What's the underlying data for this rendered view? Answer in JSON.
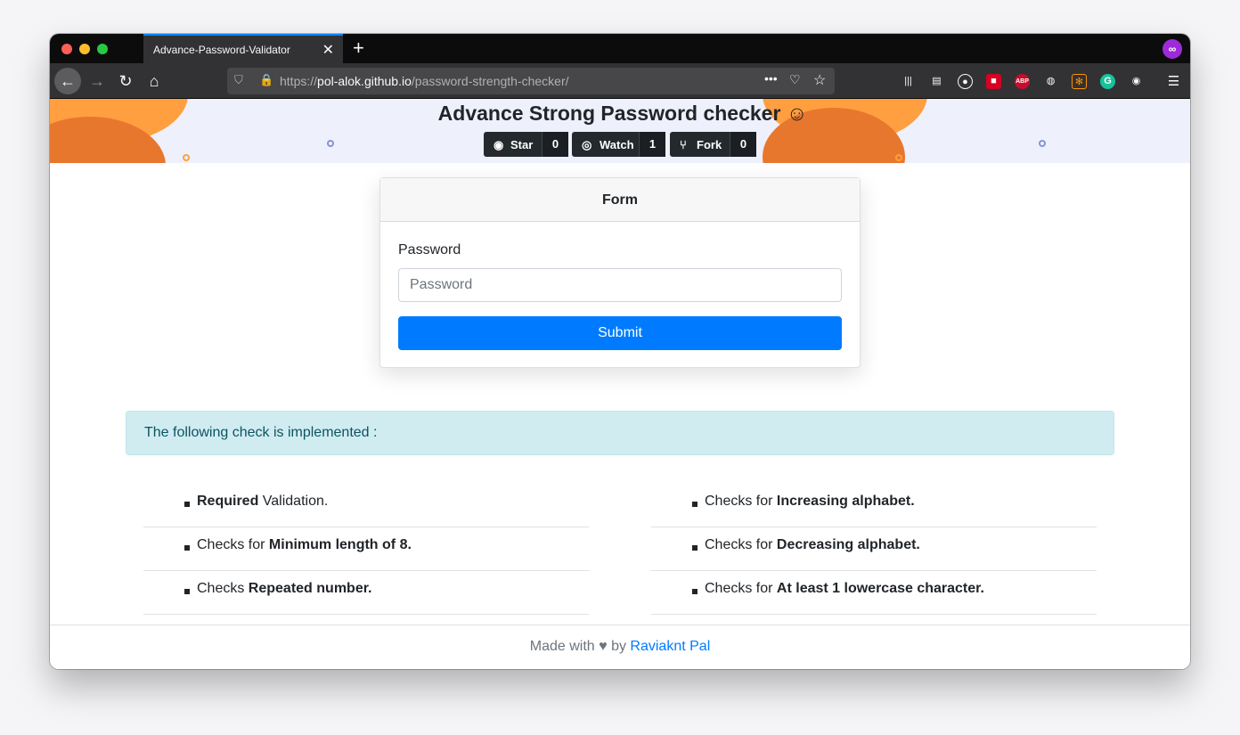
{
  "browser": {
    "tab_title": "Advance-Password-Validator",
    "url_scheme": "https://",
    "url_host": "pol-alok.github.io",
    "url_path": "/password-strength-checker/"
  },
  "hero": {
    "title": "Advance Strong Password checker",
    "emoji": "☺",
    "buttons": [
      {
        "label": "Star",
        "count": "0"
      },
      {
        "label": "Watch",
        "count": "1"
      },
      {
        "label": "Fork",
        "count": "0"
      }
    ]
  },
  "form": {
    "header": "Form",
    "password_label": "Password",
    "password_placeholder": "Password",
    "submit_label": "Submit"
  },
  "alert": {
    "text": "The following check is implemented :"
  },
  "checks_left": [
    {
      "bold": "Required",
      "rest": " Validation.",
      "prefix": ""
    },
    {
      "prefix": "Checks for ",
      "bold": "Minimum length of 8.",
      "rest": ""
    },
    {
      "prefix": "Checks ",
      "bold": "Repeated number.",
      "rest": ""
    }
  ],
  "checks_right": [
    {
      "prefix": "Checks for ",
      "bold": "Increasing alphabet.",
      "rest": ""
    },
    {
      "prefix": "Checks for ",
      "bold": "Decreasing alphabet.",
      "rest": ""
    },
    {
      "prefix": "Checks for ",
      "bold": "At least 1 lowercase character.",
      "rest": ""
    }
  ],
  "footer": {
    "prefix": "Made with",
    "heart": "♥",
    "by": "by",
    "author": "Raviaknt Pal"
  },
  "extensions": {
    "abp": "ABP"
  },
  "colors": {
    "primary": "#007bff",
    "alert_bg": "#d1ecf1",
    "github_dark": "#24292e"
  }
}
